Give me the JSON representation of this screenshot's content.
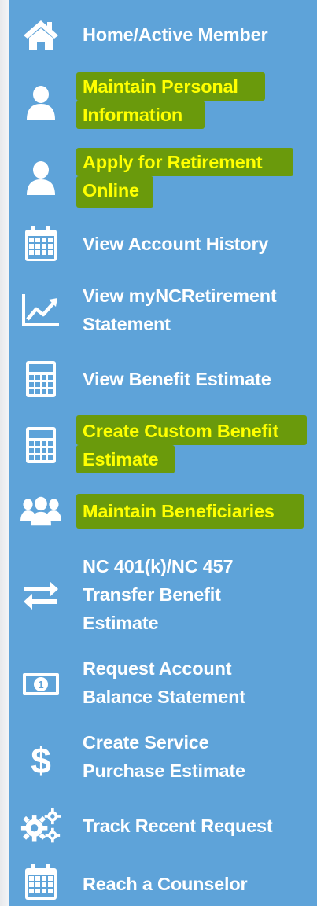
{
  "accent": {
    "menu_background": "#5ea3d9",
    "text": "#ffffff",
    "highlight_text": "#ffff00",
    "highlight_marker": "#6a9a0c"
  },
  "menu": {
    "items": [
      {
        "id": "home",
        "icon": "home-icon",
        "highlighted": false,
        "lines": [
          "Home/Active Member"
        ]
      },
      {
        "id": "maintain-personal",
        "icon": "user-icon",
        "highlighted": true,
        "lines": [
          "Maintain Personal",
          "Information"
        ]
      },
      {
        "id": "apply-retirement",
        "icon": "user-icon",
        "highlighted": true,
        "lines": [
          "Apply for Retirement",
          "Online"
        ]
      },
      {
        "id": "account-history",
        "icon": "calendar-icon",
        "highlighted": false,
        "lines": [
          "View Account History"
        ]
      },
      {
        "id": "statement",
        "icon": "line-chart-icon",
        "highlighted": false,
        "lines": [
          "View myNCRetirement",
          "Statement"
        ]
      },
      {
        "id": "benefit-estimate",
        "icon": "calculator-icon",
        "highlighted": false,
        "lines": [
          "View Benefit Estimate"
        ]
      },
      {
        "id": "custom-benefit",
        "icon": "calculator-icon",
        "highlighted": true,
        "lines": [
          "Create Custom Benefit",
          "Estimate"
        ]
      },
      {
        "id": "beneficiaries",
        "icon": "users-icon",
        "highlighted": true,
        "lines": [
          "Maintain Beneficiaries"
        ]
      },
      {
        "id": "transfer-estimate",
        "icon": "transfer-arrows-icon",
        "highlighted": false,
        "lines": [
          "NC 401(k)/NC 457",
          "Transfer Benefit",
          "Estimate"
        ]
      },
      {
        "id": "balance-statement",
        "icon": "money-bill-icon",
        "highlighted": false,
        "lines": [
          "Request Account",
          "Balance Statement"
        ]
      },
      {
        "id": "service-purchase",
        "icon": "dollar-icon",
        "highlighted": false,
        "lines": [
          "Create Service",
          "Purchase Estimate"
        ]
      },
      {
        "id": "track-request",
        "icon": "gears-icon",
        "highlighted": false,
        "lines": [
          "Track Recent Request"
        ]
      },
      {
        "id": "counselor",
        "icon": "calendar-icon",
        "highlighted": false,
        "lines": [
          "Reach a Counselor"
        ]
      }
    ]
  }
}
